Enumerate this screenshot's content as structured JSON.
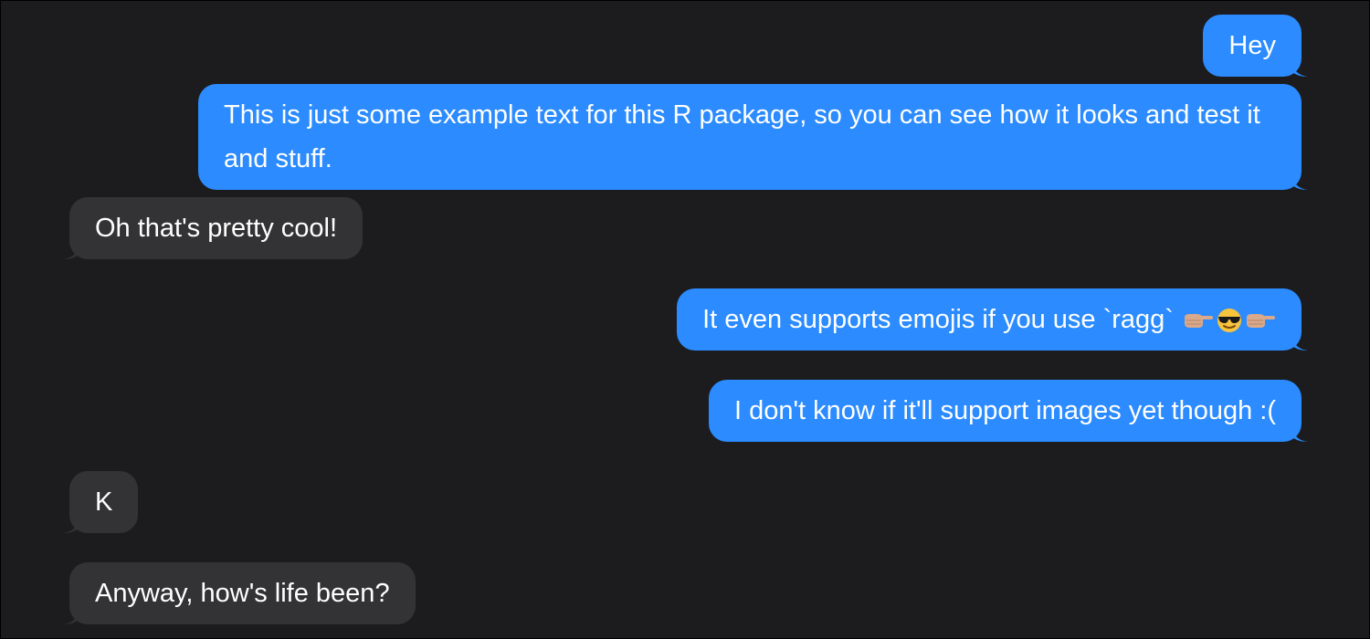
{
  "colors": {
    "background": "#1c1c1e",
    "sent_bubble": "#2b8bff",
    "received_bubble": "#333335",
    "text": "#ffffff"
  },
  "messages": [
    {
      "sender": "me",
      "text": "Hey"
    },
    {
      "sender": "me",
      "text": "This is just some example text for this R package, so you can see how it looks and test it and stuff."
    },
    {
      "sender": "them",
      "text": "Oh that's pretty cool!"
    },
    {
      "sender": "me",
      "text": "It even supports emojis if you use `ragg`",
      "emojis": [
        "backhand-index-pointing-right-icon",
        "smiling-face-with-sunglasses-icon",
        "backhand-index-pointing-right-icon"
      ]
    },
    {
      "sender": "me",
      "text": "I don't know if it'll support images yet though :("
    },
    {
      "sender": "them",
      "text": "K"
    },
    {
      "sender": "them",
      "text": "Anyway, how's life been?"
    }
  ]
}
